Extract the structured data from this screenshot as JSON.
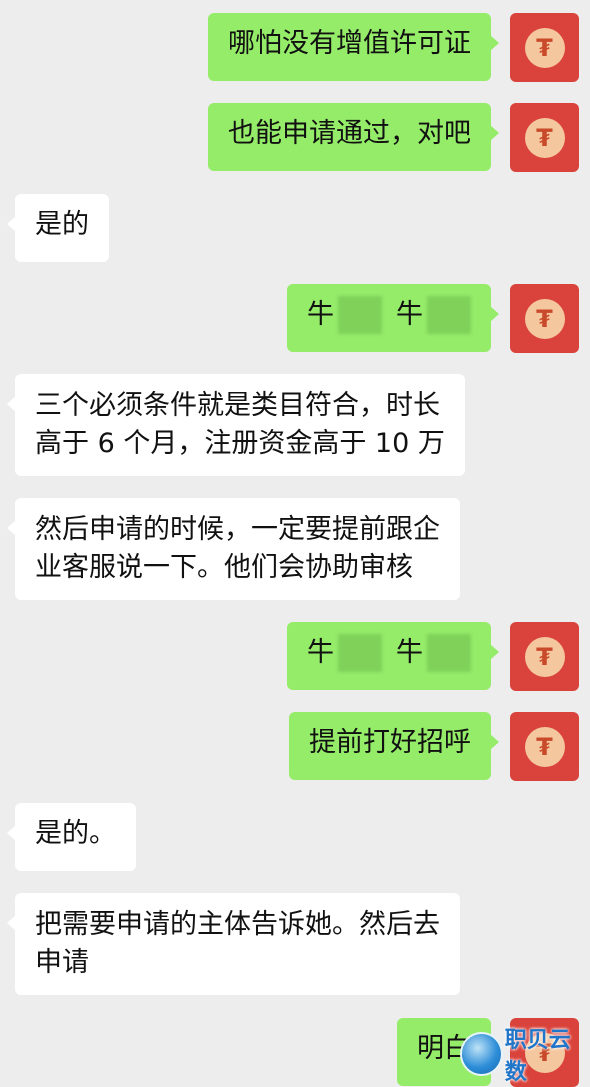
{
  "messages": [
    {
      "side": "out",
      "text": "哪怕没有增值许可证"
    },
    {
      "side": "out",
      "text": "也能申请通过，对吧"
    },
    {
      "side": "in",
      "text": "是的"
    },
    {
      "side": "out",
      "parts": [
        "牛",
        "牛"
      ]
    },
    {
      "side": "in",
      "lines": [
        "三个必须条件就是类目符合，时长",
        "高于 6 个月，注册资金高于 10 万"
      ]
    },
    {
      "side": "in",
      "lines": [
        "然后申请的时候，一定要提前跟企",
        "业客服说一下。他们会协助审核"
      ]
    },
    {
      "side": "out",
      "parts": [
        "牛",
        "牛"
      ]
    },
    {
      "side": "out",
      "text": "提前打好招呼"
    },
    {
      "side": "in",
      "text": "是的。"
    },
    {
      "side": "in",
      "lines": [
        "把需要申请的主体告诉她。然后去",
        "申请"
      ]
    },
    {
      "side": "out",
      "text": "明白"
    }
  ],
  "avatar": {
    "glyph": "₮",
    "bg": "#d9433b",
    "coin": "#f5c79e"
  },
  "watermark": {
    "text": "职贝云数"
  },
  "colors": {
    "outgoing": "#95ec69",
    "incoming": "#ffffff",
    "background": "#ededed"
  }
}
